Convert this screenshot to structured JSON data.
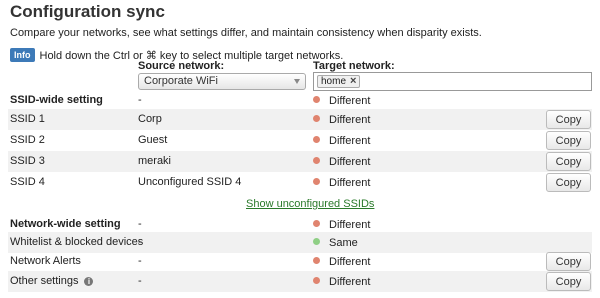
{
  "page": {
    "title": "Configuration sync",
    "description": "Compare your networks, see what settings differ, and maintain consistency when disparity exists.",
    "info_badge": "Info",
    "info_text": "Hold down the Ctrl or ⌘ key to select multiple target networks."
  },
  "source": {
    "label": "Source network:",
    "value": "Corporate WiFi"
  },
  "target": {
    "label": "Target network:",
    "tag": "home",
    "tag_remove": "×"
  },
  "colors": {
    "different": "#e0846f",
    "same": "#8fcf85",
    "info": "#3d7ab8",
    "link": "#2a7a2a"
  },
  "copy_label": "Copy",
  "ssid_header": {
    "setting": "SSID-wide setting",
    "source": "-",
    "status": "Different"
  },
  "ssids": [
    {
      "setting": "SSID 1",
      "source": "Corp",
      "status": "Different",
      "copy": "Copy"
    },
    {
      "setting": "SSID 2",
      "source": "Guest",
      "status": "Different",
      "copy": "Copy"
    },
    {
      "setting": "SSID 3",
      "source": "meraki",
      "status": "Different",
      "copy": "Copy"
    },
    {
      "setting": "SSID 4",
      "source": "Unconfigured SSID 4",
      "status": "Different",
      "copy": "Copy"
    }
  ],
  "show_unconfigured": "Show unconfigured SSIDs",
  "network_header": {
    "setting": "Network-wide setting",
    "source": "-",
    "status": "Different"
  },
  "network_rows": [
    {
      "setting": "Whitelist & blocked devices",
      "source": "-",
      "status": "Same"
    },
    {
      "setting": "Network Alerts",
      "source": "-",
      "status": "Different",
      "copy": "Copy"
    },
    {
      "setting": "Other settings",
      "help": "i",
      "source": "-",
      "status": "Different",
      "copy": "Copy"
    }
  ]
}
